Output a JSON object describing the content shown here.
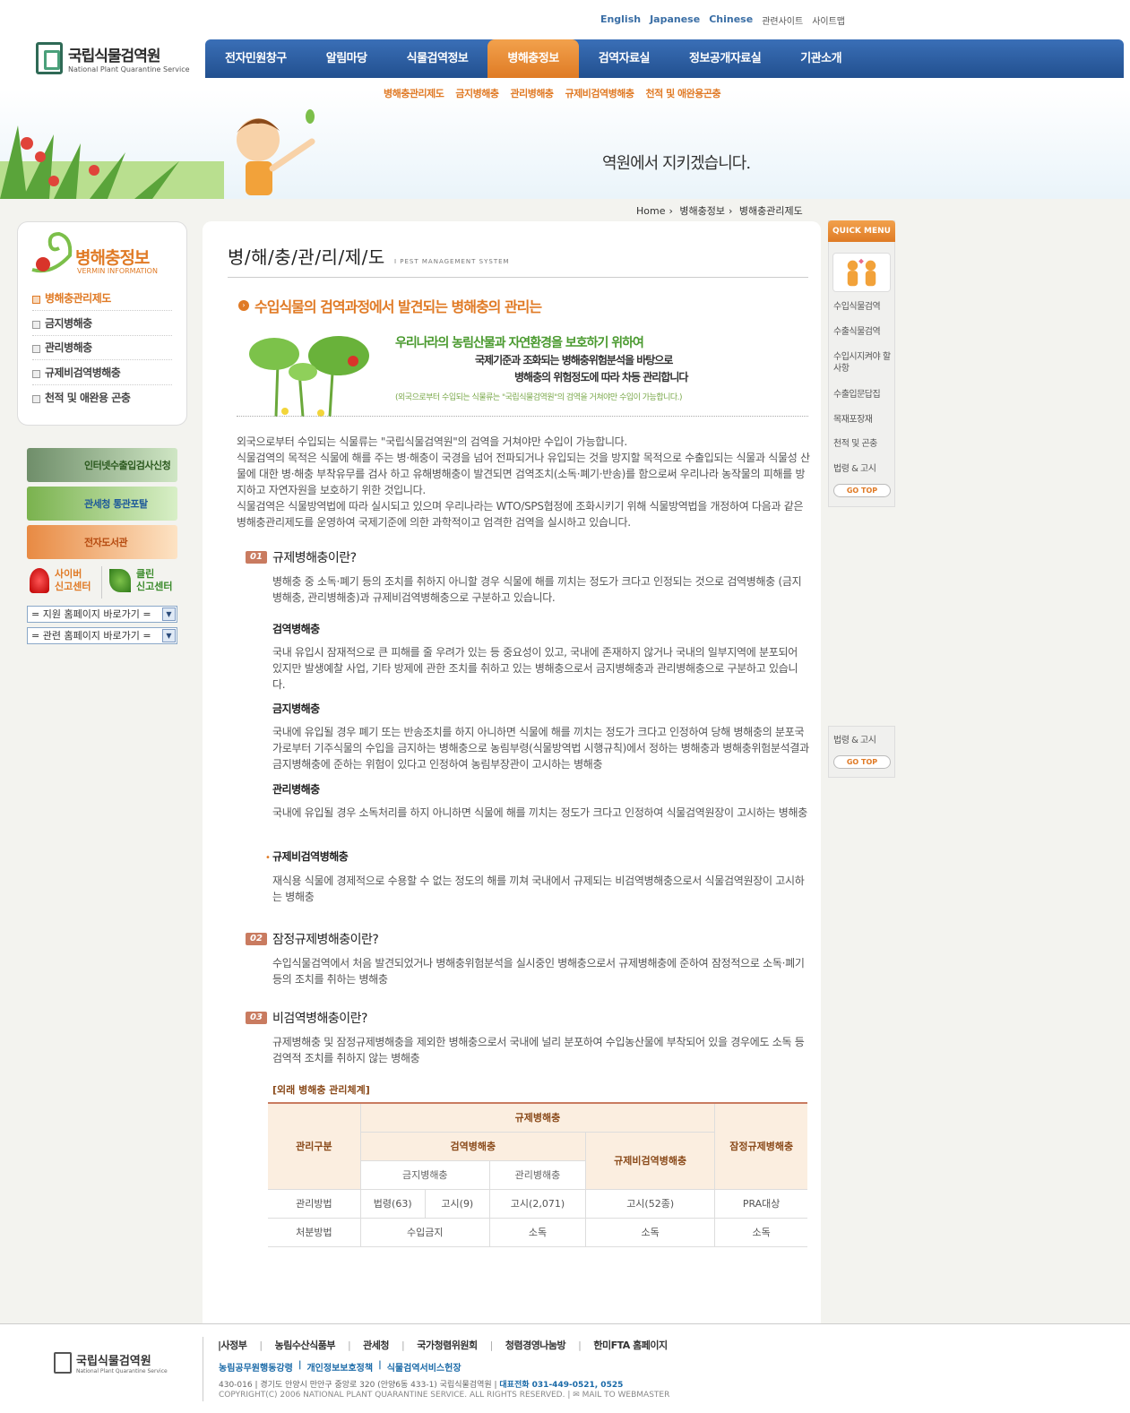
{
  "header": {
    "util_links": [
      "English",
      "Japanese",
      "Chinese",
      "관련사이트",
      "사이트맵"
    ],
    "logo_ko": "국립식물검역원",
    "logo_en": "National Plant Quarantine Service",
    "gnb": [
      "전자민원창구",
      "알림마당",
      "식물검역정보",
      "병해충정보",
      "검역자료실",
      "정보공개자료실",
      "기관소개"
    ],
    "gnb_active": "병해충정보",
    "lnb": [
      "병해충관리제도",
      "금지병해충",
      "관리병해충",
      "규제비검역병해충",
      "천적 및 애완용곤충"
    ],
    "slogan": "역원에서 지키겠습니다."
  },
  "breadcrumb": [
    "Home",
    "병해충정보",
    "병해충관리제도"
  ],
  "sidebar": {
    "title": "병해충정보",
    "subtitle": "VERMIN INFORMATION",
    "items": [
      "병해충관리제도",
      "금지병해충",
      "관리병해충",
      "규제비검역병해충",
      "천적 및 애완용 곤충"
    ],
    "active": "병해충관리제도",
    "banners": [
      "인터넷수출입검사신청",
      "관세청 통관포탈",
      "전자도서관"
    ],
    "cyber": [
      "사이버",
      "신고센터"
    ],
    "clean": [
      "클린",
      "신고센터"
    ],
    "select1": "= 지원 홈페이지 바로가기 =",
    "select2": "= 관련 홈페이지 바로가기 ="
  },
  "main": {
    "title": "병/해/충/관/리/제/도",
    "title_en": "I  PEST  MANAGEMENT SYSTEM",
    "subtitle": "수입식물의 검역과정에서 발견되는 병해충의 관리는",
    "intro1": "우리나라의 농림산물과 자연환경을 보호하기 위하여",
    "intro2": "국제기준과 조화되는 병해충위험분석을 바탕으로",
    "intro3": "병해충의 위험정도에 따라 차등 관리합니다",
    "intro4": "(외국으로부터 수입되는 식물류는 \"국립식물검역원\"의 검역을 거쳐야만 수입이 가능합니다.)",
    "intro_para": "외국으로부터 수입되는 식물류는 \"국립식물검역원\"의 검역을 거쳐야만 수입이 가능합니다.\n식물검역의 목적은 식물에 해를 주는 병·해충이 국경을 넘어 전파되거나 유입되는 것을 방지할 목적으로 수출입되는 식물과 식물성 산물에 대한 병·해충 부착유무를 검사 하고 유해병해충이 발견되면 검역조치(소독·폐기·반송)를 함으로써 우리나라 농작물의 피해를 방지하고 자연자원을 보호하기 위한 것입니다.\n식물검역은 식물방역법에 따라 실시되고 있으며 우리나라는 WTO/SPS협정에 조화시키기 위해 식물방역법을 개정하여 다음과 같은 병해충관리제도를 운영하여 국제기준에 의한 과학적이고 엄격한 검역을 실시하고 있습니다.",
    "s1_num": "01",
    "s1_title": "규제병해충이란?",
    "s1_body": "병해충 중 소독·폐기 등의 조치를 취하지 아니할 경우 식물에 해를 끼치는 정도가 크다고 인정되는 것으로 검역병해충 (금지병해충, 관리병해충)과 규제비검역병해충으로 구분하고 있습니다.",
    "s1a_title": "검역병해충",
    "s1a_body": "국내 유입시 잠재적으로 큰 피해를 줄 우려가 있는 등 중요성이 있고, 국내에 존재하지 않거나 국내의 일부지역에 분포되어 있지만 발생예찰 사업, 기타 방제에 관한 조치를 취하고 있는 병해충으로서 금지병해충과 관리병해충으로 구분하고 있습니다.",
    "s1b_title": "금지병해충",
    "s1b_body": "국내에 유입될 경우 폐기 또는 반송조치를 하지 아니하면 식물에 해를 끼치는 정도가 크다고 인정하여 당해 병해충의 분포국가로부터 기주식물의 수입을 금지하는 병해충으로 농림부령(식물방역법 시행규칙)에서 정하는 병해충과 병해충위험분석결과 금지병해충에 준하는 위험이 있다고 인정하여 농림부장관이 고시하는 병해충",
    "s1c_title": "관리병해충",
    "s1c_body": "국내에 유입될 경우 소독처리를 하지 아니하면 식물에 해를 끼치는 정도가 크다고 인정하여 식물검역원장이 고시하는 병해충",
    "s1d_title": "규제비검역병해충",
    "s1d_body": "재식용 식물에 경제적으로 수용할 수 없는 정도의 해를 끼쳐 국내에서 규제되는 비검역병해충으로서 식물검역원장이 고시하는 병해충",
    "s2_num": "02",
    "s2_title": "잠정규제병해충이란?",
    "s2_body": "수입식물검역에서 처음 발견되었거나 병해충위험분석을 실시중인 병해충으로서 규제병해충에 준하여 잠정적으로 소독·폐기 등의 조치를 취하는 병해충",
    "s3_num": "03",
    "s3_title": "비검역병해충이란?",
    "s3_body": "규제병해충 및 잠정규제병해충을 제외한 병해충으로서 국내에 널리 분포하여 수입농산물에 부착되어 있을 경우에도 소독 등 검역적 조치를 취하지 않는 병해충",
    "table_caption": "[외래 병해충 관리체계]",
    "table": {
      "h_mgmt": "관리구분",
      "h_reg": "규제병해충",
      "h_quar": "검역병해충",
      "h_rnq": "규제비검역병해충",
      "h_prov": "잠정규제병해충",
      "h_ban": "금지병해충",
      "h_ctrl": "관리병해충",
      "r1_label": "관리방법",
      "r1_law": "법령(63)",
      "r1_notice": "고시(9)",
      "r1_ctrl": "고시(2,071)",
      "r1_rnq": "고시(52종)",
      "r1_prov": "PRA대상",
      "r2_label": "처분방법",
      "r2_ban": "수입금지",
      "r2_ctrl": "소독",
      "r2_rnq": "소독",
      "r2_prov": "소독"
    }
  },
  "quick_menu": {
    "title": "QUICK MENU",
    "items": [
      "수입식물검역",
      "수출식물검역",
      "수입시지켜야 할 사항",
      "수출입문답집",
      "목재포장재",
      "천적 및 곤충",
      "법령 & 고시"
    ],
    "go_top": "GO TOP",
    "items2": [
      "법령 & 고시"
    ]
  },
  "footer": {
    "logo_ko": "국립식물검역원",
    "logo_en": "National Plant Quarantine Service",
    "links": [
      "|사정부",
      "농림수산식품부",
      "관세청",
      "국가청렴위원회",
      "청렴경영나눔방",
      "한미FTA 홈페이지"
    ],
    "policy": [
      "농림공무원행동강령",
      "개인정보보호정책",
      "식물검역서비스헌장"
    ],
    "address": "430-016  |  경기도 안양시 만안구 중앙로 320 (안양6동 433-1) 국립식물검역원  |",
    "phone_label": "대표전화 031-449-0521, 0525",
    "copyright": "COPYRIGHT(C) 2006 NATIONAL PLANT QUARANTINE SERVICE. ALL RIGHTS RESERVED.  |  ✉ MAIL TO WEBMASTER"
  }
}
